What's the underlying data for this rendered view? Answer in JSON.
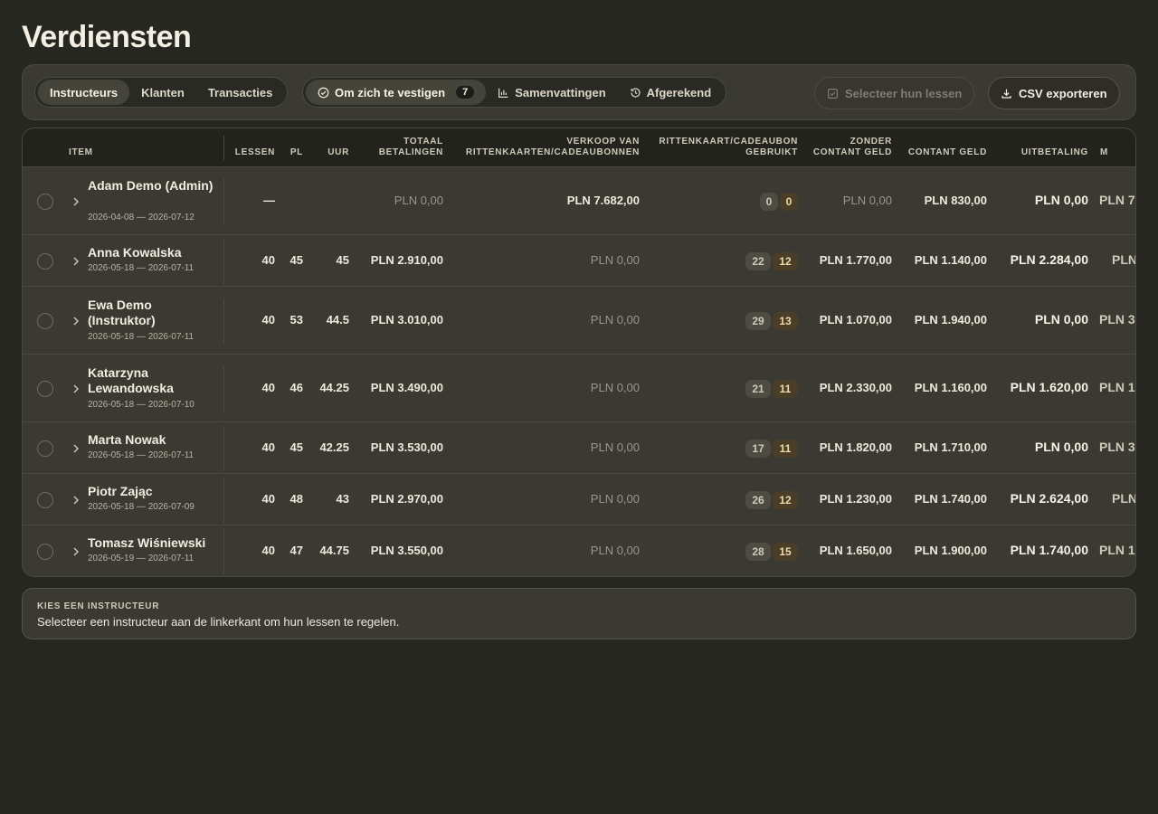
{
  "page": {
    "title": "Verdiensten"
  },
  "toolbar": {
    "view_tabs": [
      {
        "label": "Instructeurs",
        "active": true
      },
      {
        "label": "Klanten",
        "active": false
      },
      {
        "label": "Transacties",
        "active": false
      }
    ],
    "filter_tabs": [
      {
        "label": "Om zich te vestigen",
        "icon": "check-circle-icon",
        "count": "7",
        "active": true
      },
      {
        "label": "Samenvattingen",
        "icon": "bar-chart-icon",
        "active": false
      },
      {
        "label": "Afgerekend",
        "icon": "history-icon",
        "active": false
      }
    ],
    "select_lessons_label": "Selecteer hun lessen",
    "export_label": "CSV exporteren"
  },
  "table": {
    "headers": {
      "item": "Item",
      "lessen": "Lessen",
      "pl": "PL",
      "uur": "Uur",
      "totaal_1": "Totaal",
      "totaal_2": "betalingen",
      "verkoop_1": "Verkoop van",
      "verkoop_2": "rittenkaarten/cadeaubonnen",
      "gebruikt_1": "Rittenkaart/cadeaubon",
      "gebruikt_2": "gebruikt",
      "zonder_1": "Zonder",
      "zonder_2": "contant geld",
      "contant": "Contant geld",
      "uitbetaling": "Uitbetaling",
      "next": "M"
    },
    "rows": [
      {
        "name": "Adam Demo (Admin)",
        "dates": "2026-04-08 — 2026-07-12",
        "lessen": "—",
        "pl": "",
        "uur": "",
        "totaal": "PLN 0,00",
        "verkoop": "PLN 7.682,00",
        "used_a": "0",
        "used_b": "0",
        "zonder": "PLN 0,00",
        "contant": "PLN 830,00",
        "uitbetaling": "PLN 0,00",
        "next": "PLN 7"
      },
      {
        "name": "Anna Kowalska",
        "dates": "2026-05-18 — 2026-07-11",
        "lessen": "40",
        "pl": "45",
        "uur": "45",
        "totaal": "PLN 2.910,00",
        "verkoop": "PLN 0,00",
        "used_a": "22",
        "used_b": "12",
        "zonder": "PLN 1.770,00",
        "contant": "PLN 1.140,00",
        "uitbetaling": "PLN 2.284,00",
        "next": "PLN"
      },
      {
        "name": "Ewa Demo (Instruktor)",
        "dates": "2026-05-18 — 2026-07-11",
        "lessen": "40",
        "pl": "53",
        "uur": "44.5",
        "totaal": "PLN 3.010,00",
        "verkoop": "PLN 0,00",
        "used_a": "29",
        "used_b": "13",
        "zonder": "PLN 1.070,00",
        "contant": "PLN 1.940,00",
        "uitbetaling": "PLN 0,00",
        "next": "PLN 3"
      },
      {
        "name": "Katarzyna Lewandowska",
        "dates": "2026-05-18 — 2026-07-10",
        "lessen": "40",
        "pl": "46",
        "uur": "44.25",
        "totaal": "PLN 3.490,00",
        "verkoop": "PLN 0,00",
        "used_a": "21",
        "used_b": "11",
        "zonder": "PLN 2.330,00",
        "contant": "PLN 1.160,00",
        "uitbetaling": "PLN 1.620,00",
        "next": "PLN 1"
      },
      {
        "name": "Marta Nowak",
        "dates": "2026-05-18 — 2026-07-11",
        "lessen": "40",
        "pl": "45",
        "uur": "42.25",
        "totaal": "PLN 3.530,00",
        "verkoop": "PLN 0,00",
        "used_a": "17",
        "used_b": "11",
        "zonder": "PLN 1.820,00",
        "contant": "PLN 1.710,00",
        "uitbetaling": "PLN 0,00",
        "next": "PLN 3"
      },
      {
        "name": "Piotr Zając",
        "dates": "2026-05-18 — 2026-07-09",
        "lessen": "40",
        "pl": "48",
        "uur": "43",
        "totaal": "PLN 2.970,00",
        "verkoop": "PLN 0,00",
        "used_a": "26",
        "used_b": "12",
        "zonder": "PLN 1.230,00",
        "contant": "PLN 1.740,00",
        "uitbetaling": "PLN 2.624,00",
        "next": "PLN"
      },
      {
        "name": "Tomasz Wiśniewski",
        "dates": "2026-05-19 — 2026-07-11",
        "lessen": "40",
        "pl": "47",
        "uur": "44.75",
        "totaal": "PLN 3.550,00",
        "verkoop": "PLN 0,00",
        "used_a": "28",
        "used_b": "15",
        "zonder": "PLN 1.650,00",
        "contant": "PLN 1.900,00",
        "uitbetaling": "PLN 1.740,00",
        "next": "PLN 1"
      }
    ]
  },
  "hint": {
    "title": "Kies een instructeur",
    "text": "Selecteer een instructeur aan de linkerkant om hun lessen te regelen."
  }
}
